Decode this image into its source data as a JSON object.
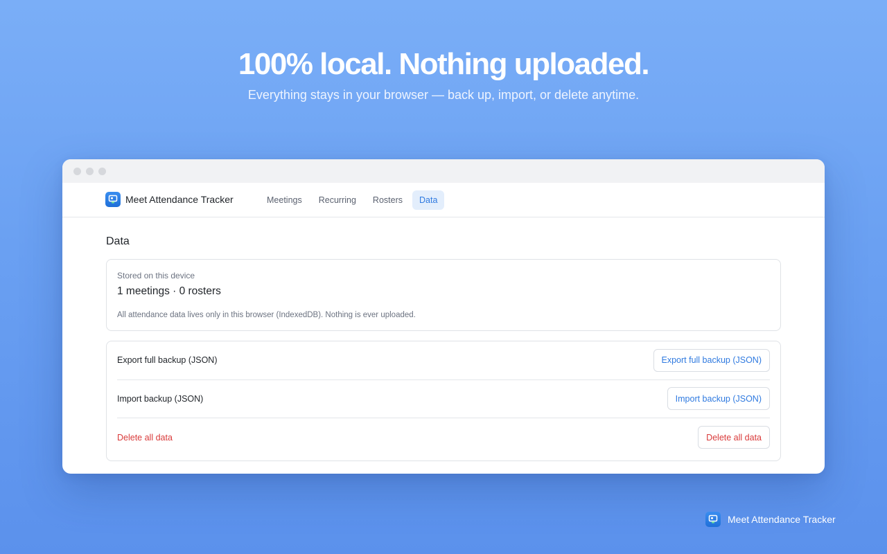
{
  "hero": {
    "title": "100% local. Nothing uploaded.",
    "subtitle": "Everything stays in your browser — back up, import, or delete anytime."
  },
  "app": {
    "name": "Meet Attendance Tracker",
    "icon": "meet-app-icon",
    "accent": "#2f7ae0",
    "danger": "#d93a3a"
  },
  "nav": {
    "tabs": [
      {
        "label": "Meetings",
        "active": false
      },
      {
        "label": "Recurring",
        "active": false
      },
      {
        "label": "Rosters",
        "active": false
      },
      {
        "label": "Data",
        "active": true
      }
    ]
  },
  "page": {
    "title": "Data",
    "storage": {
      "label": "Stored on this device",
      "summary": "1 meetings · 0 rosters",
      "note": "All attendance data lives only in this browser (IndexedDB). Nothing is ever uploaded."
    },
    "actions": [
      {
        "label": "Export full backup (JSON)",
        "button": "Export full backup (JSON)",
        "danger": false
      },
      {
        "label": "Import backup (JSON)",
        "button": "Import backup (JSON)",
        "danger": false
      },
      {
        "label": "Delete all data",
        "button": "Delete all data",
        "danger": true
      }
    ]
  },
  "footer": {
    "brand": "Meet Attendance Tracker"
  }
}
